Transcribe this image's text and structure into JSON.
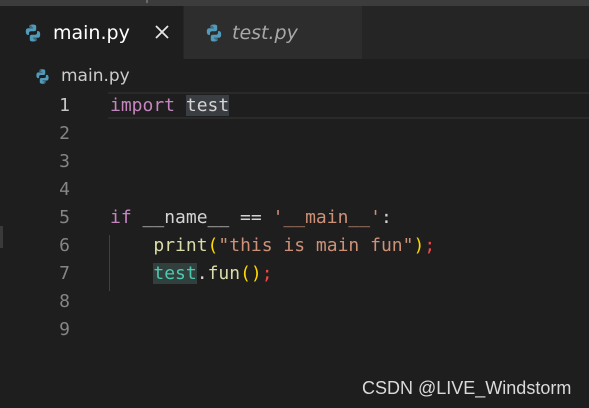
{
  "tabs": [
    {
      "label": "main.py",
      "active": true,
      "icon": "python-icon"
    },
    {
      "label": "test.py",
      "active": false,
      "icon": "python-icon"
    }
  ],
  "close_icon": "close-icon",
  "breadcrumb": {
    "label": "main.py",
    "icon": "python-icon"
  },
  "editor": {
    "current_line": 1,
    "lines": [
      {
        "number": "1",
        "segments": [
          {
            "text": "import",
            "class": "kw"
          },
          {
            "text": " ",
            "class": "plain"
          },
          {
            "text": "test",
            "class": "sel"
          }
        ]
      },
      {
        "number": "2",
        "segments": []
      },
      {
        "number": "3",
        "segments": []
      },
      {
        "number": "4",
        "segments": []
      },
      {
        "number": "5",
        "segments": [
          {
            "text": "if",
            "class": "kw"
          },
          {
            "text": " __name__ == ",
            "class": "plain"
          },
          {
            "text": "'__main__'",
            "class": "str"
          },
          {
            "text": ":",
            "class": "plain"
          }
        ]
      },
      {
        "number": "6",
        "segments": [
          {
            "text": "    ",
            "class": "plain"
          },
          {
            "text": "print",
            "class": "fn"
          },
          {
            "text": "(",
            "class": "paren"
          },
          {
            "text": "\"this is main fun\"",
            "class": "str"
          },
          {
            "text": ")",
            "class": "paren"
          },
          {
            "text": ";",
            "class": "semi-red"
          }
        ]
      },
      {
        "number": "7",
        "segments": [
          {
            "text": "    ",
            "class": "plain"
          },
          {
            "text": "test",
            "class": "mod-hl"
          },
          {
            "text": ".",
            "class": "plain"
          },
          {
            "text": "fun",
            "class": "fn"
          },
          {
            "text": "()",
            "class": "paren"
          },
          {
            "text": ";",
            "class": "semi-red"
          }
        ]
      },
      {
        "number": "8",
        "segments": []
      },
      {
        "number": "9",
        "segments": []
      }
    ]
  },
  "watermark": "CSDN @LIVE_Windstorm",
  "colors": {
    "background": "#1e1e1e",
    "tabbar": "#252526",
    "keyword": "#c586c0",
    "string": "#ce9178",
    "function": "#dcdcaa",
    "module": "#4ec9b0",
    "python_blue": "#519aba"
  }
}
